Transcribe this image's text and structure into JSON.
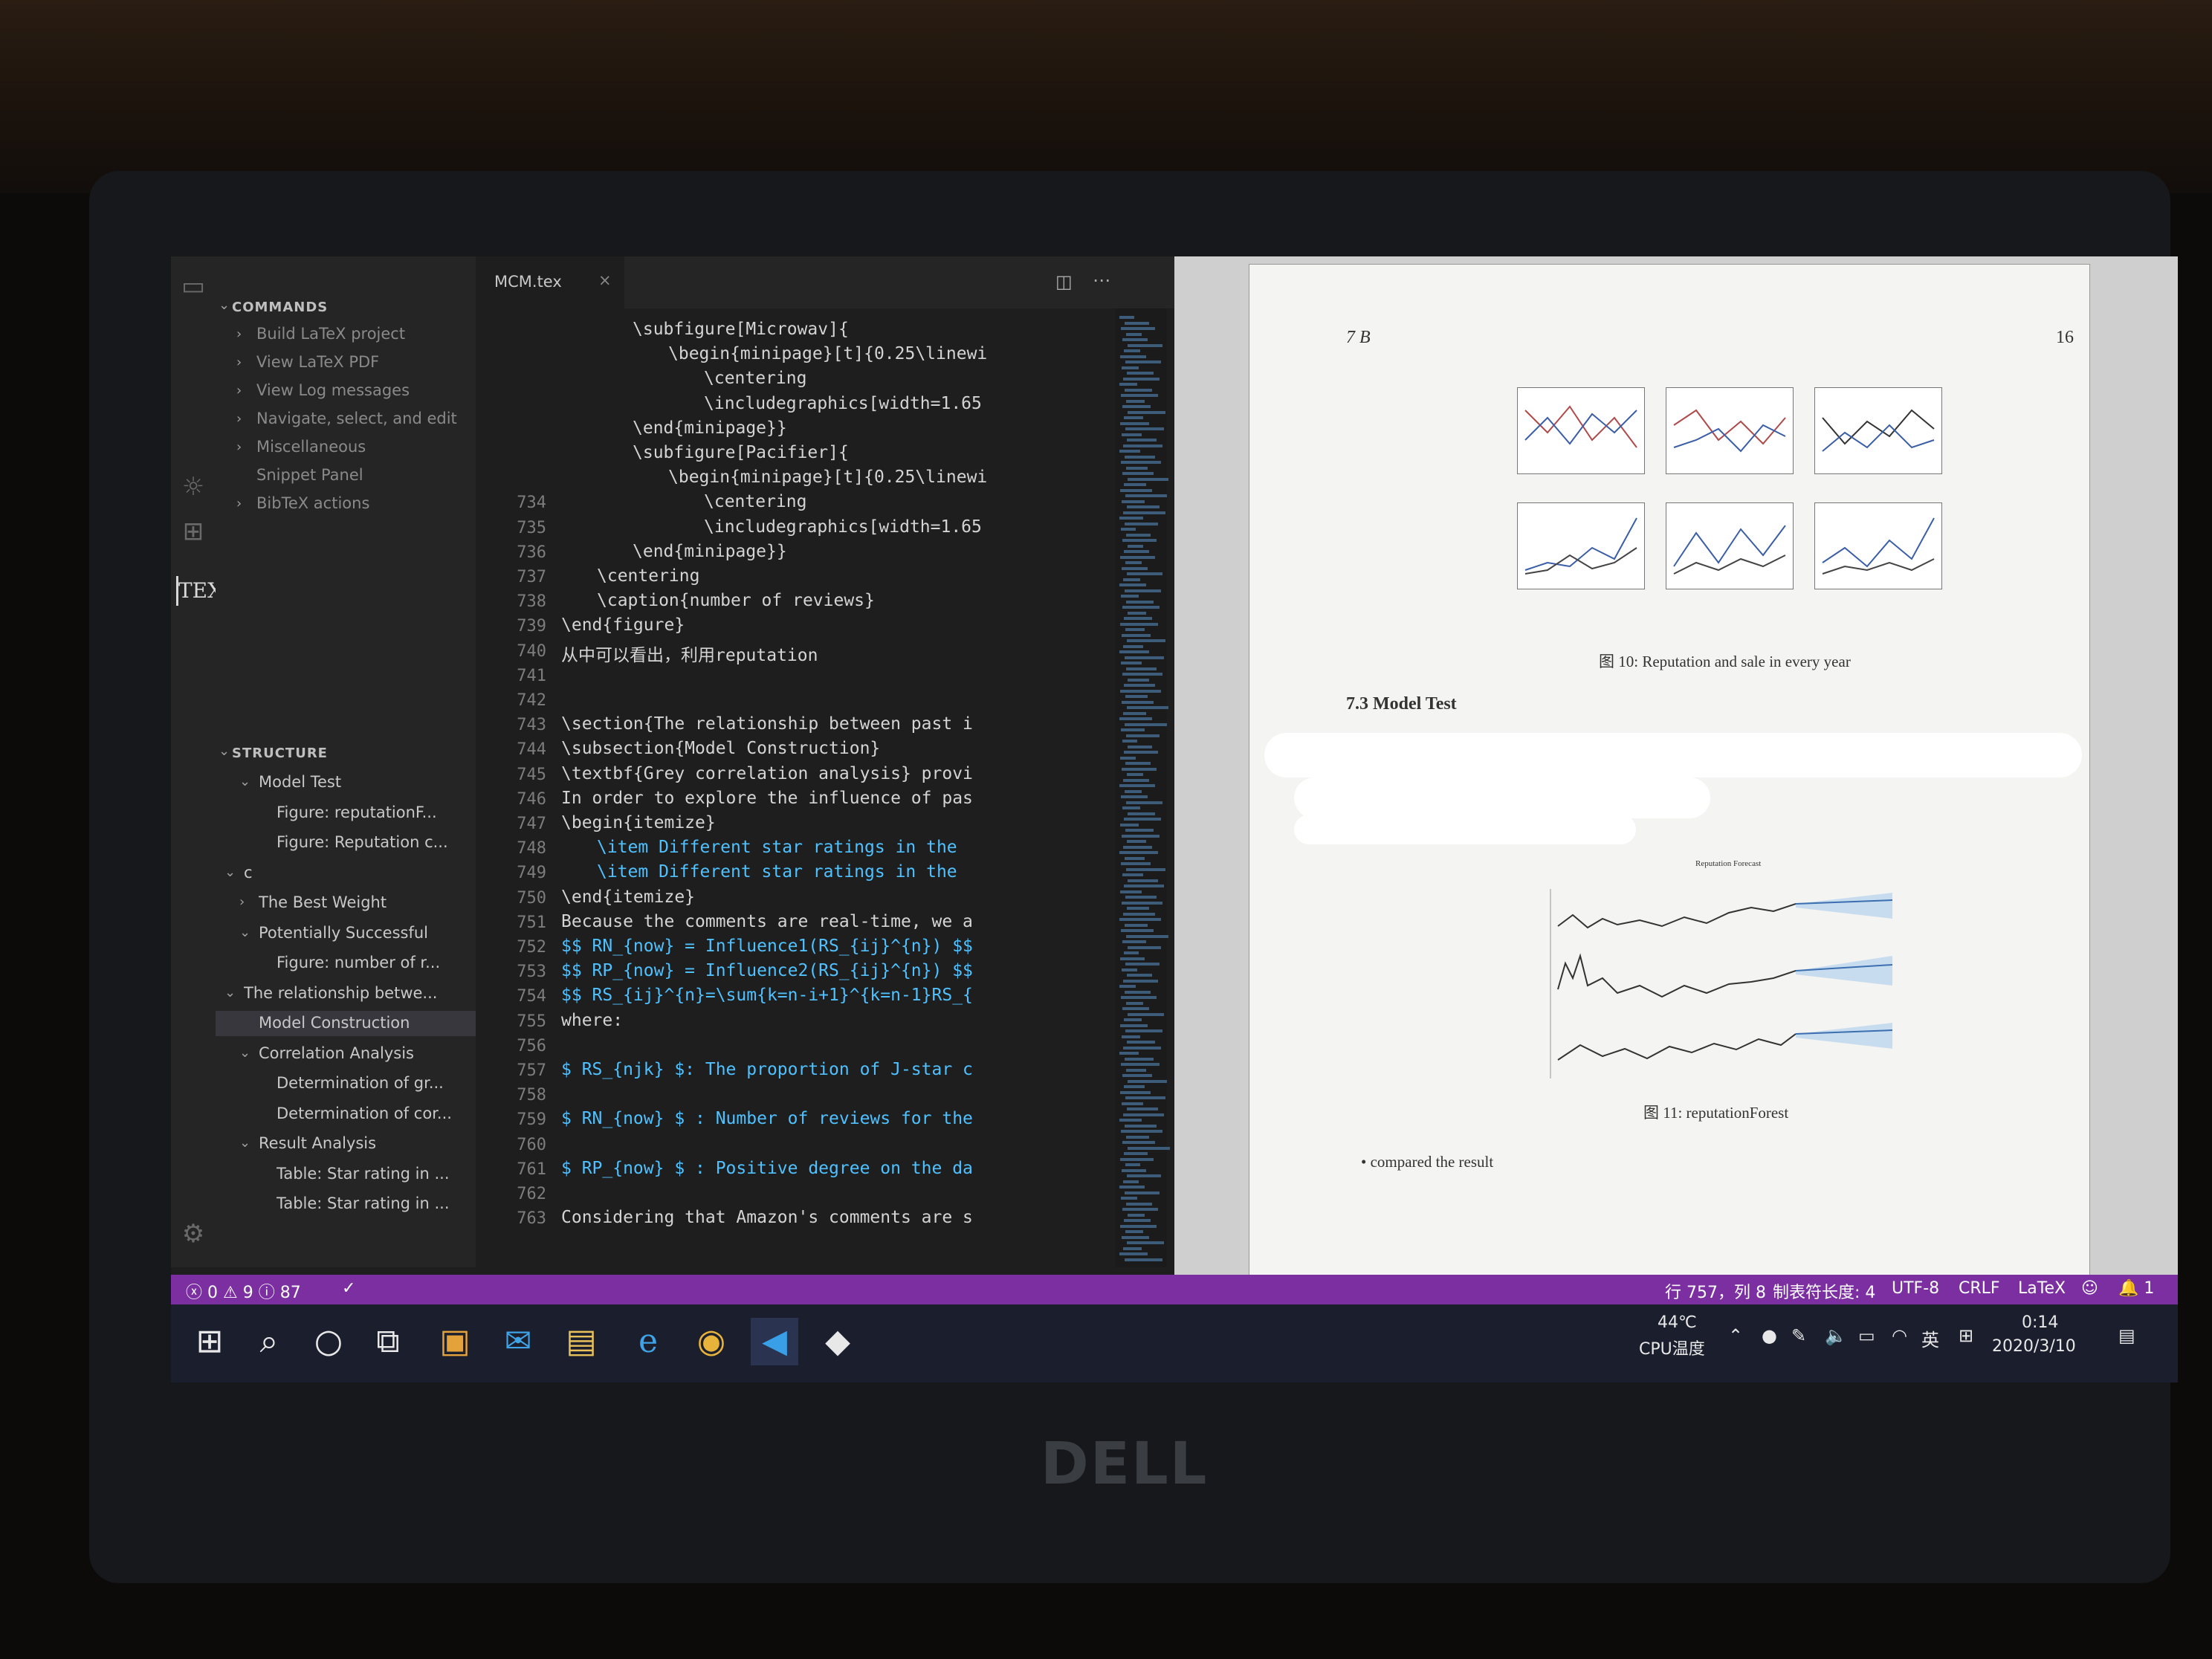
{
  "editor": {
    "tab": "MCM.tex",
    "lines": [
      {
        "n": "",
        "t": "\\subfigure[Microwav]{",
        "indent": 2
      },
      {
        "n": "",
        "t": "\\begin{minipage}[t]{0.25\\linewi",
        "indent": 3
      },
      {
        "n": "",
        "t": "\\centering",
        "indent": 4
      },
      {
        "n": "",
        "t": "\\includegraphics[width=1.65",
        "indent": 4
      },
      {
        "n": "",
        "t": "\\end{minipage}}",
        "indent": 2
      },
      {
        "n": "",
        "t": "\\subfigure[Pacifier]{",
        "indent": 2
      },
      {
        "n": "",
        "t": "\\begin{minipage}[t]{0.25\\linewi",
        "indent": 3
      },
      {
        "n": "734",
        "t": "\\centering",
        "indent": 4
      },
      {
        "n": "735",
        "t": "\\includegraphics[width=1.65",
        "indent": 4
      },
      {
        "n": "736",
        "t": "\\end{minipage}}",
        "indent": 2
      },
      {
        "n": "737",
        "t": "\\centering",
        "indent": 1
      },
      {
        "n": "738",
        "t": "\\caption{number of reviews}",
        "indent": 1
      },
      {
        "n": "739",
        "t": "\\end{figure}",
        "indent": 0
      },
      {
        "n": "740",
        "t": "从中可以看出，利用reputation",
        "indent": 0
      },
      {
        "n": "741",
        "t": "",
        "indent": 0
      },
      {
        "n": "742",
        "t": "",
        "indent": 0
      },
      {
        "n": "743",
        "t": "\\section{The relationship between past i",
        "indent": 0
      },
      {
        "n": "744",
        "t": "\\subsection{Model Construction}",
        "indent": 0
      },
      {
        "n": "745",
        "t": "\\textbf{Grey correlation analysis} provi",
        "indent": 0
      },
      {
        "n": "746",
        "t": "In order to explore the influence of pas",
        "indent": 0
      },
      {
        "n": "747",
        "t": "\\begin{itemize}",
        "indent": 0
      },
      {
        "n": "748",
        "t": "\\item Different star ratings in the",
        "indent": 1
      },
      {
        "n": "749",
        "t": "\\item Different star ratings in the",
        "indent": 1
      },
      {
        "n": "750",
        "t": "\\end{itemize}",
        "indent": 0
      },
      {
        "n": "751",
        "t": "Because the comments are real-time, we a",
        "indent": 0
      },
      {
        "n": "752",
        "t": "$$ RN_{now} = Influence1(RS_{ij}^{n}) $$",
        "indent": 0
      },
      {
        "n": "753",
        "t": "$$ RP_{now} = Influence2(RS_{ij}^{n}) $$",
        "indent": 0
      },
      {
        "n": "754",
        "t": "$$ RS_{ij}^{n}=\\sum{k=n-i+1}^{k=n-1}RS_{",
        "indent": 0
      },
      {
        "n": "755",
        "t": "where:",
        "indent": 0
      },
      {
        "n": "756",
        "t": "",
        "indent": 0
      },
      {
        "n": "757",
        "t": "$ RS_{njk} $: The proportion of J-star c",
        "indent": 0
      },
      {
        "n": "758",
        "t": "",
        "indent": 0
      },
      {
        "n": "759",
        "t": "$ RN_{now} $ : Number of reviews for the",
        "indent": 0
      },
      {
        "n": "760",
        "t": "",
        "indent": 0
      },
      {
        "n": "761",
        "t": "$ RP_{now} $ : Positive degree on the da",
        "indent": 0
      },
      {
        "n": "762",
        "t": "",
        "indent": 0
      },
      {
        "n": "763",
        "t": "Considering that Amazon's comments are s",
        "indent": 0
      }
    ]
  },
  "sidebar": {
    "commands_header": "COMMANDS",
    "commands": [
      "Build LaTeX project",
      "View LaTeX PDF",
      "View Log messages",
      "Navigate, select, and edit",
      "Miscellaneous",
      "Snippet Panel",
      "BibTeX actions"
    ],
    "structure_header": "STRUCTURE",
    "structure": [
      {
        "label": "Model Test",
        "level": 1,
        "chev": "v"
      },
      {
        "label": "Figure: reputationF...",
        "level": 2,
        "chev": ""
      },
      {
        "label": "Figure: Reputation c...",
        "level": 2,
        "chev": ""
      },
      {
        "label": "c",
        "level": 0,
        "chev": "v"
      },
      {
        "label": "The Best Weight",
        "level": 1,
        "chev": ">"
      },
      {
        "label": "Potentially Successful",
        "level": 1,
        "chev": "v"
      },
      {
        "label": "Figure: number of r...",
        "level": 2,
        "chev": ""
      },
      {
        "label": "The relationship betwe...",
        "level": 0,
        "chev": "v"
      },
      {
        "label": "Model Construction",
        "level": 1,
        "chev": "",
        "active": true
      },
      {
        "label": "Correlation Analysis",
        "level": 1,
        "chev": "v"
      },
      {
        "label": "Determination of gr...",
        "level": 2,
        "chev": ""
      },
      {
        "label": "Determination of cor...",
        "level": 2,
        "chev": ""
      },
      {
        "label": "Result Analysis",
        "level": 1,
        "chev": "v"
      },
      {
        "label": "Table: Star rating in ...",
        "level": 2,
        "chev": ""
      },
      {
        "label": "Table: Star rating in ...",
        "level": 2,
        "chev": ""
      }
    ]
  },
  "activity": {
    "tex_label": "TEX"
  },
  "pdf": {
    "header_left": "7  B",
    "header_right": "16",
    "fig10_caption": "图 10: Reputation and sale in every year",
    "section": "7.3   Model Test",
    "forecast_title": "Reputation Forecast",
    "fig11_caption": "图 11: reputationForest",
    "bullet": "• compared the result"
  },
  "statusbar": {
    "errors": "0",
    "warnings": "9",
    "info": "87",
    "position": "行 757，列 8",
    "tab_size": "制表符长度: 4",
    "encoding": "UTF-8",
    "eol": "CRLF",
    "language": "LaTeX",
    "notifications": "1"
  },
  "taskbar": {
    "temp": "44℃",
    "temp_label": "CPU温度",
    "ime": "英",
    "time": "0:14",
    "date": "2020/3/10"
  },
  "brand": "DELL",
  "colors": {
    "statusbar": "#7b2fa0",
    "editor_bg": "#1e1e1e",
    "sidebar_bg": "#252526",
    "keyword": "#4fc1ff"
  }
}
